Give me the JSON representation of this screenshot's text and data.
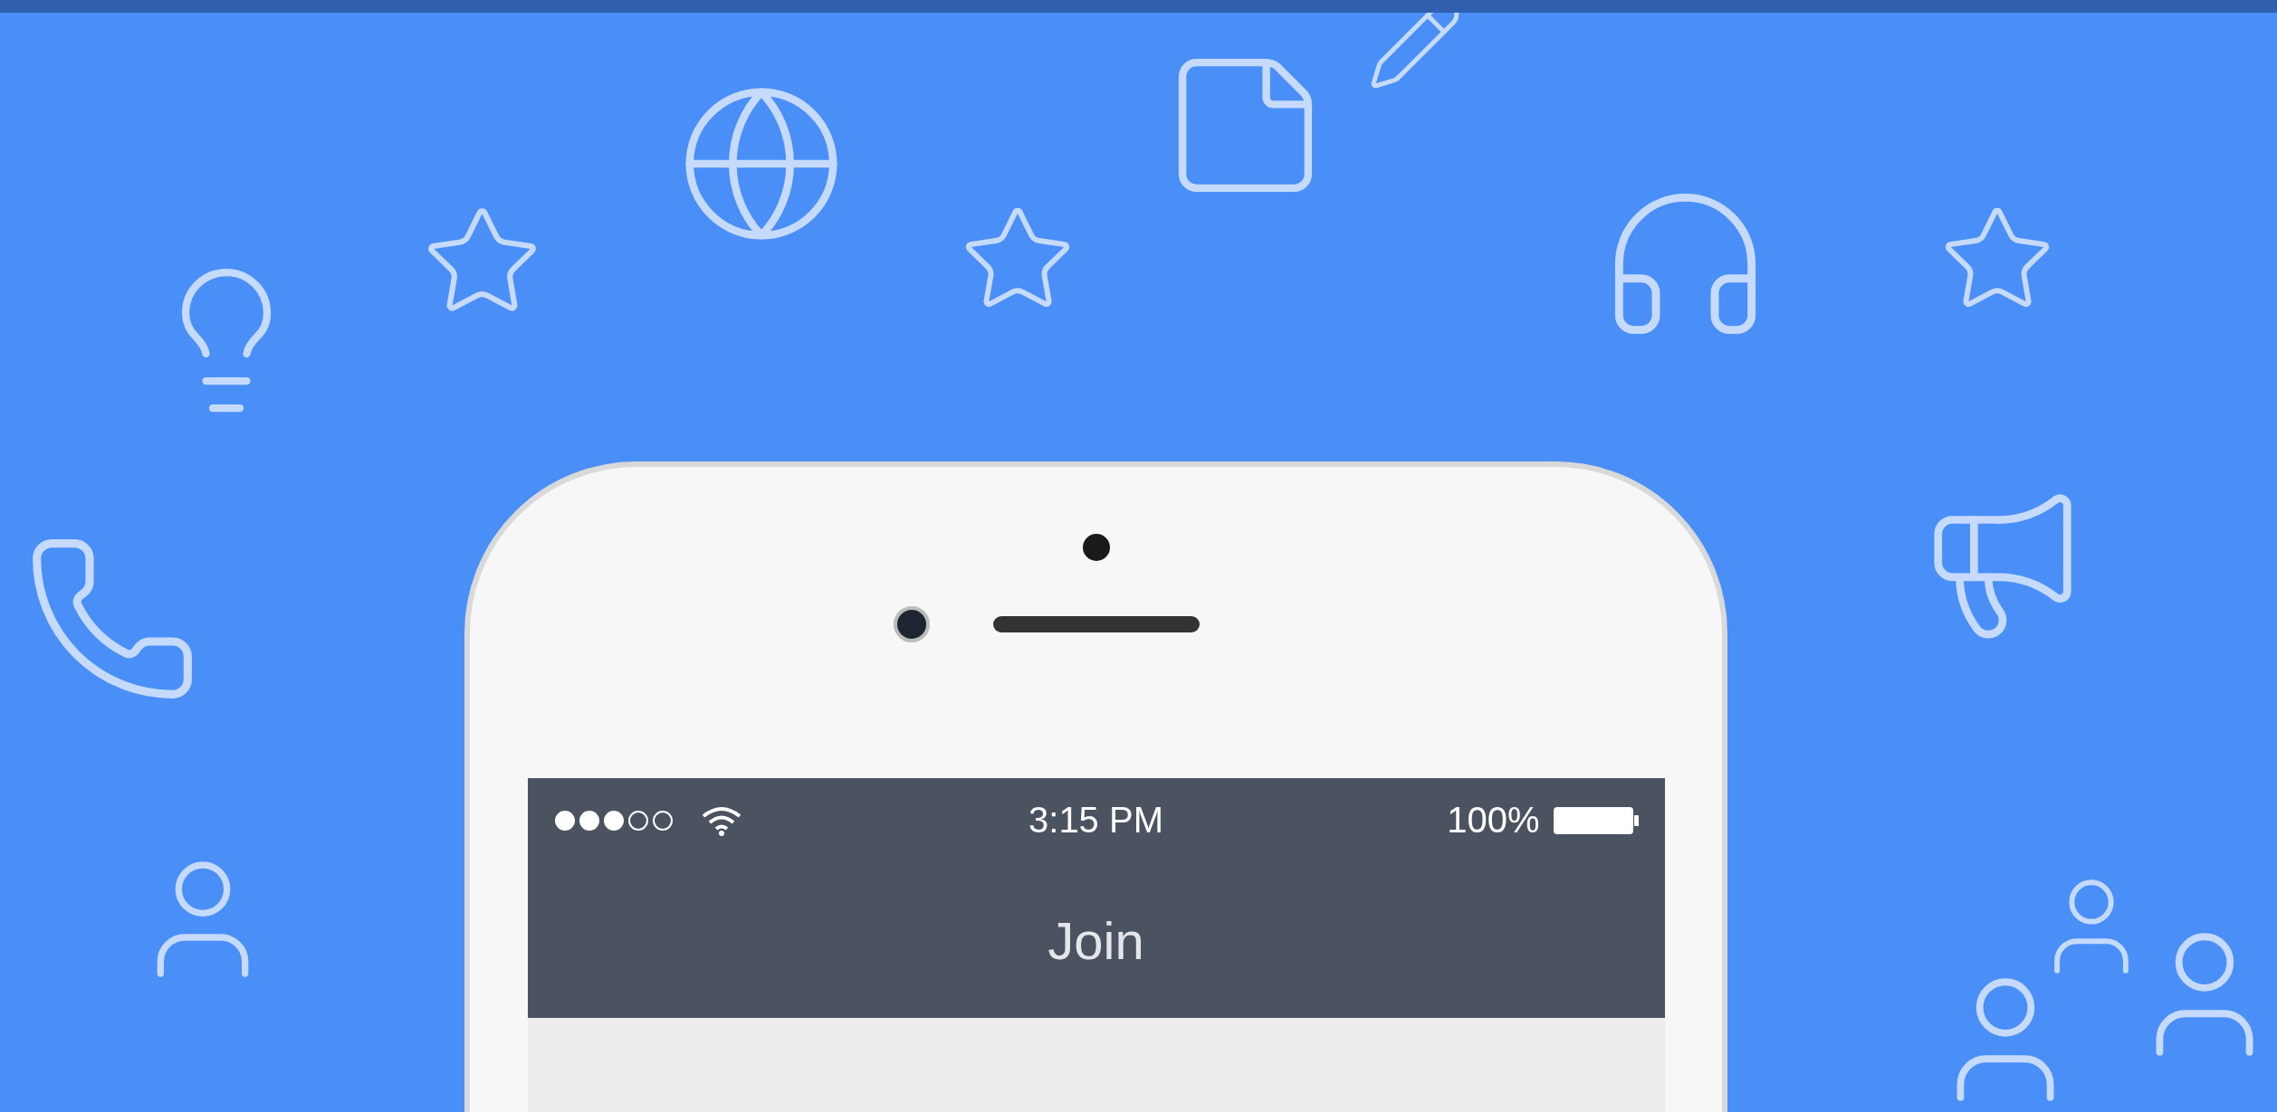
{
  "status_bar": {
    "time": "3:15 PM",
    "battery": "100%"
  },
  "nav_bar": {
    "title": "Join"
  }
}
